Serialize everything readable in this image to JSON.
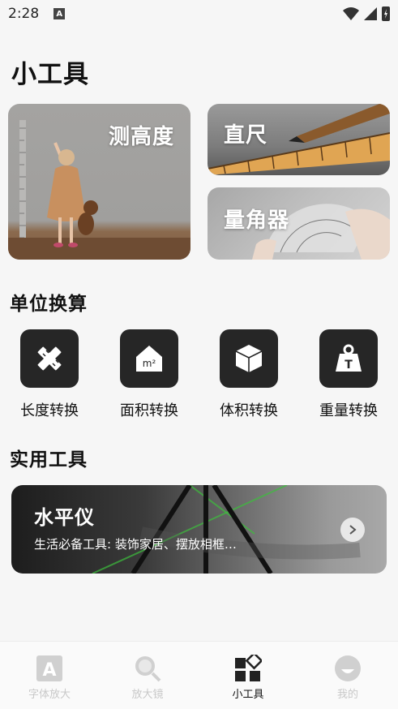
{
  "status_bar": {
    "time": "2:28",
    "notification_badge": "A"
  },
  "page": {
    "title": "小工具"
  },
  "tools": [
    {
      "label": "测高度",
      "icon": "height-photo"
    },
    {
      "label": "直尺",
      "icon": "ruler-photo"
    },
    {
      "label": "量角器",
      "icon": "protractor-photo"
    }
  ],
  "unit_section": {
    "title": "单位换算",
    "items": [
      {
        "label": "长度转换",
        "icon": "ruler-pencil-icon"
      },
      {
        "label": "面积转换",
        "icon": "house-m2-icon"
      },
      {
        "label": "体积转换",
        "icon": "cube-icon"
      },
      {
        "label": "重量转换",
        "icon": "weight-icon"
      }
    ]
  },
  "practical_section": {
    "title": "实用工具",
    "level": {
      "title": "水平仪",
      "subtitle": "生活必备工具: 装饰家居、摆放相框…"
    }
  },
  "bottom_nav": {
    "items": [
      {
        "label": "字体放大",
        "icon": "font-a-icon",
        "active": false
      },
      {
        "label": "放大镜",
        "icon": "magnifier-icon",
        "active": false
      },
      {
        "label": "小工具",
        "icon": "tools-grid-icon",
        "active": true
      },
      {
        "label": "我的",
        "icon": "profile-icon",
        "active": false
      }
    ]
  },
  "colors": {
    "accent": "#262626",
    "inactive_nav": "#c8c8c8",
    "background": "#f6f6f6"
  }
}
